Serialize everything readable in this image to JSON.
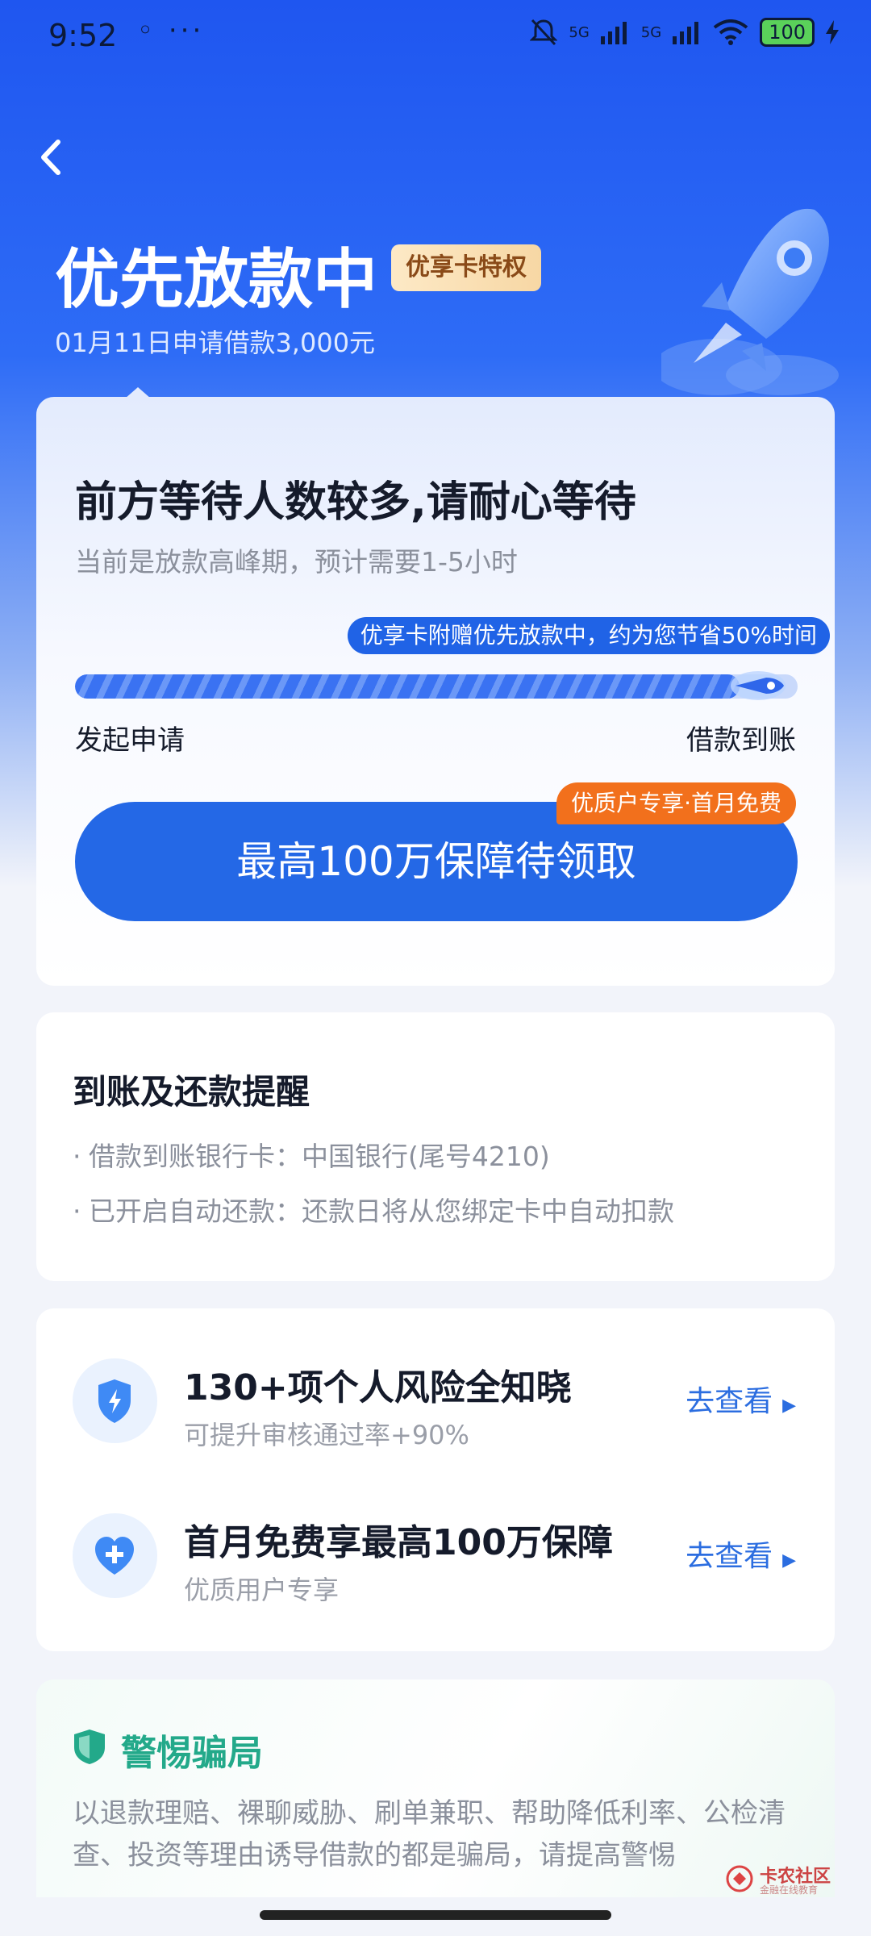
{
  "status_bar": {
    "time": "9:52",
    "dots": "◦ ···",
    "signal_1": "5G",
    "signal_2": "5G",
    "battery": "100"
  },
  "header": {
    "title": "优先放款中",
    "badge": "优享卡特权",
    "subtitle": "01月11日申请借款3,000元"
  },
  "progress_card": {
    "title": "前方等待人数较多,请耐心等待",
    "subtitle": "当前是放款高峰期，预计需要1-5小时",
    "tip": "优享卡附赠优先放款中，约为您节省50%时间",
    "progress": 0.92,
    "start_label": "发起申请",
    "end_label": "借款到账",
    "promo_tag": "优质户专享·首月免费",
    "button_label": "最高100万保障待领取"
  },
  "reminder_card": {
    "title": "到账及还款提醒",
    "lines": [
      "借款到账银行卡：中国银行(尾号4210)",
      "已开启自动还款：还款日将从您绑定卡中自动扣款"
    ]
  },
  "services_card": {
    "items": [
      {
        "title": "130+项个人风险全知晓",
        "subtitle": "可提升审核通过率+90%",
        "link": "去查看"
      },
      {
        "title": "首月免费享最高100万保障",
        "subtitle": "优质用户专享",
        "link": "去查看"
      }
    ]
  },
  "fraud_card": {
    "title": "警惕骗局",
    "text": "以退款理赔、裸聊威胁、刷单兼职、帮助降低利率、公检清查、投资等理由诱导借款的都是骗局，请提高警惕"
  },
  "watermark": {
    "main": "卡农社区",
    "sub": "金融在线教育"
  },
  "colors": {
    "primary": "#2468e6",
    "orange": "#f2701c",
    "green": "#23a98a"
  }
}
